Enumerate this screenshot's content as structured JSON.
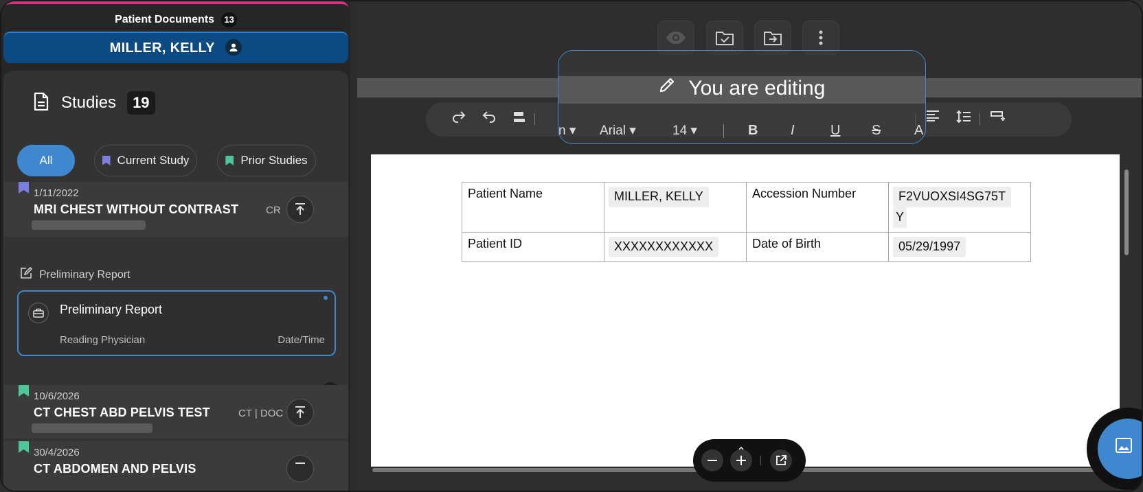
{
  "patient_docs": {
    "title": "Patient Documents",
    "count": "13"
  },
  "patient": {
    "name": "MILLER, KELLY"
  },
  "studies": {
    "label": "Studies",
    "count": "19",
    "filters": [
      {
        "label": "All",
        "active": true
      },
      {
        "label": "Current Study",
        "flag_color": "#7b7fe0"
      },
      {
        "label": "Prior Studies",
        "flag_color": "#4fc59a"
      }
    ],
    "items": [
      {
        "date": "1/11/2022",
        "name": "MRI CHEST WITHOUT CONTRAST",
        "modality": "CR",
        "flag_color": "#7b7fe0"
      },
      {
        "date": "10/6/2026",
        "name": "CT CHEST ABD PELVIS TEST",
        "modality": "CT | DOC",
        "flag_color": "#4fc59a"
      },
      {
        "date": "30/4/2026",
        "name": "CT ABDOMEN AND PELVIS",
        "modality": "",
        "flag_color": "#4fc59a"
      }
    ]
  },
  "preliminary": {
    "section_label": "Preliminary Report",
    "card_title": "Preliminary Report",
    "reading_physician": "Reading Physician",
    "date_time": "Date/Time"
  },
  "editor": {
    "banner": "You are editing",
    "font_family": "Arial",
    "font_size": "14",
    "style_hint": "n"
  },
  "document": {
    "rows": [
      [
        "Patient Name",
        "MILLER, KELLY",
        "Accession Number",
        "F2VUOXSI4SG75T",
        "Y"
      ],
      [
        "Patient ID",
        "XXXXXXXXXXXX",
        "Date of Birth",
        "05/29/1997"
      ]
    ]
  },
  "colors": {
    "accent": "#3f88cf",
    "patient_bar": "#0b4a82",
    "top_stripe": "#d63384"
  }
}
